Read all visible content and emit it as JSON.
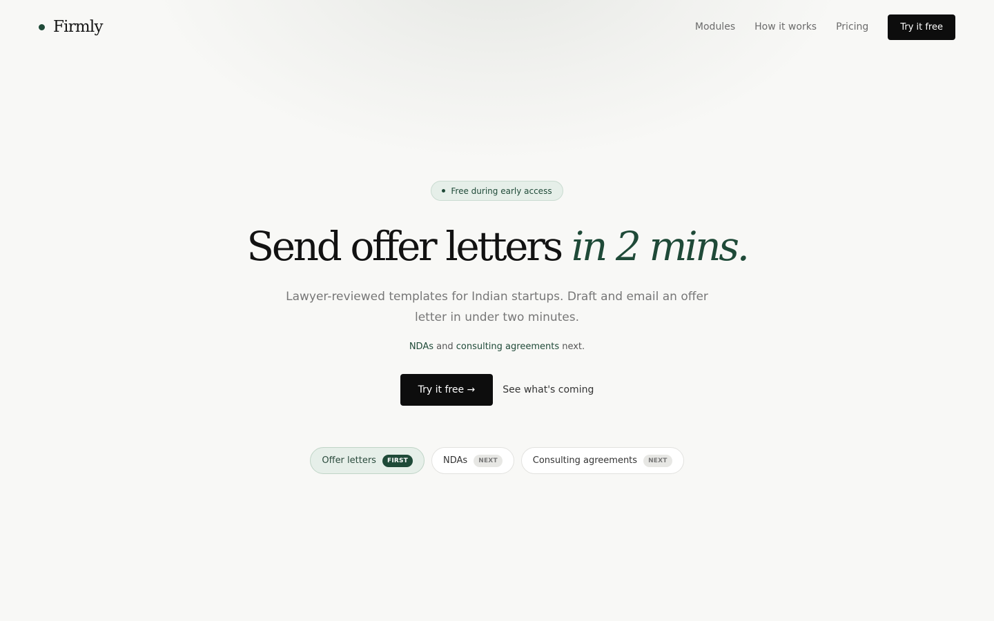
{
  "brand": {
    "name": "Firmly",
    "accent": "#1f4a38"
  },
  "nav": {
    "links": [
      "Modules",
      "How it works",
      "Pricing"
    ],
    "cta": "Try it free"
  },
  "hero": {
    "pill": "Free during early access",
    "headline": "Send offer letters",
    "headline_accent": "in 2 mins.",
    "subtitle": "Lawyer-reviewed templates for Indian startups. Draft and email an offer letter in under two minutes.",
    "note": {
      "link1": "NDAs",
      "and": "and",
      "link2": "consulting agreements",
      "tail": "next."
    },
    "cta_primary": "Try it free →",
    "cta_secondary": "See what's coming"
  },
  "modules": [
    {
      "label": "Offer letters",
      "badge": "FIRST",
      "active": true
    },
    {
      "label": "NDAs",
      "badge": "NEXT",
      "active": false
    },
    {
      "label": "Consulting agreements",
      "badge": "NEXT",
      "active": false
    }
  ]
}
